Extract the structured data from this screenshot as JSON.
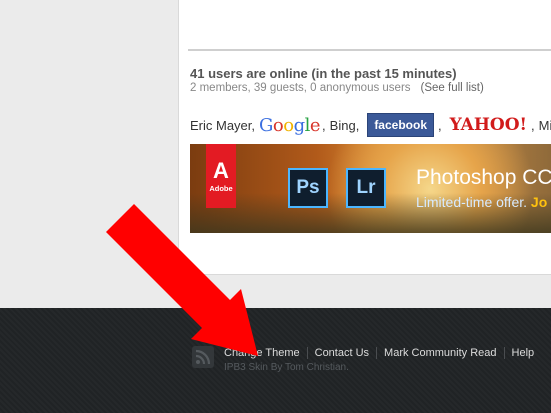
{
  "online": {
    "title": "41 users are online (in the past 15 minutes)",
    "summary": "2 members, 39 guests, 0 anonymous users",
    "full_list_link": "(See full list)"
  },
  "users": {
    "user1": "Eric Mayer,",
    "bot_google": "Google",
    "sep1": ",",
    "bot_bing": "Bing,",
    "bot_facebook": "facebook",
    "sep2": ",",
    "bot_yahoo": "YAHOO!",
    "sep3": ",",
    "user2": "MikeN"
  },
  "banner": {
    "brand": "Adobe",
    "app1": "Ps",
    "app2": "Lr",
    "title": "Photoshop CC a",
    "subtitle": "Limited-time offer.",
    "cta_fragment": "Jo"
  },
  "footer": {
    "links": [
      "Change Theme",
      "Contact Us",
      "Mark Community Read",
      "Help"
    ],
    "credit": "IPB3 Skin By Tom Christian."
  },
  "colors": {
    "annotation_arrow": "#ff0000",
    "footer_bg": "#202325",
    "facebook_blue": "#3b5998",
    "yahoo_red": "#d11b1b"
  }
}
